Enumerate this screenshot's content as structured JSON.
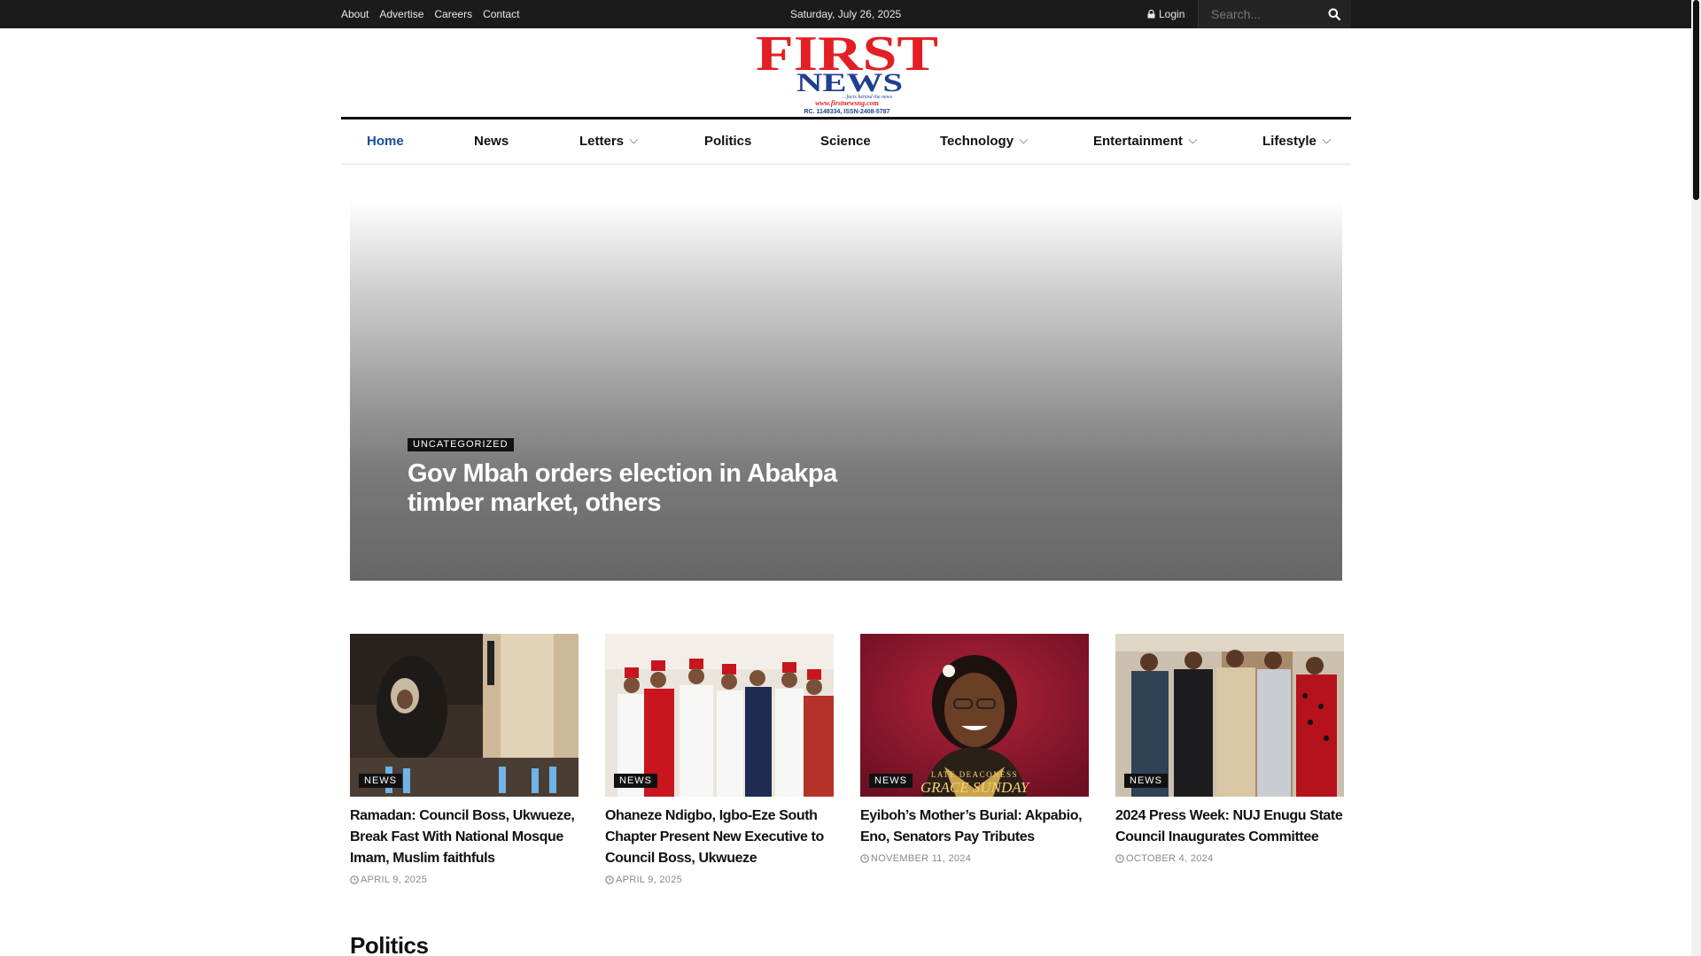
{
  "topbar": {
    "links": [
      "About",
      "Advertise",
      "Careers",
      "Contact"
    ],
    "date": "Saturday, July 26, 2025",
    "login_label": "Login",
    "search_placeholder": "Search..."
  },
  "logo": {
    "word1": "FIRST",
    "word2": "NEWS",
    "tagline": "...facts behind the news",
    "url": "www.firstnewsng.com",
    "reg": "RC. 1148334, ISSN-2408-5787"
  },
  "nav": {
    "items": [
      {
        "label": "Home",
        "active": true,
        "dropdown": false
      },
      {
        "label": "News",
        "active": false,
        "dropdown": false
      },
      {
        "label": "Letters",
        "active": false,
        "dropdown": true
      },
      {
        "label": "Politics",
        "active": false,
        "dropdown": false
      },
      {
        "label": "Science",
        "active": false,
        "dropdown": false
      },
      {
        "label": "Technology",
        "active": false,
        "dropdown": true
      },
      {
        "label": "Entertainment",
        "active": false,
        "dropdown": true
      },
      {
        "label": "Lifestyle",
        "active": false,
        "dropdown": true
      }
    ]
  },
  "hero": {
    "category": "UNCATEGORIZED",
    "headline": "Gov Mbah orders election in Abakpa timber market, others"
  },
  "cards": [
    {
      "category": "NEWS",
      "title": "Ramadan: Council Boss, Ukwueze, Break Fast With National Mosque Imam, Muslim faithfuls",
      "date": "APRIL 9, 2025"
    },
    {
      "category": "NEWS",
      "title": "Ohaneze Ndigbo, Igbo-Eze South Chapter Present New Executive to Council Boss, Ukwueze",
      "date": "APRIL 9, 2025"
    },
    {
      "category": "NEWS",
      "title": "Eyiboh’s Mother’s Burial: Akpabio, Eno, Senators Pay Tributes",
      "date": "NOVEMBER 11, 2024",
      "image_caption_1": "LATE DEACONESS",
      "image_caption_2": "GRACE SUNDAY"
    },
    {
      "category": "NEWS",
      "title": "2024 Press Week: NUJ Enugu State Council Inaugurates Committee",
      "date": "OCTOBER 4, 2024"
    }
  ],
  "section": {
    "title": "Politics"
  },
  "colors": {
    "topbar": "#1b1b1b",
    "accent": "#174e96",
    "logo_red": "#e31e24",
    "logo_blue": "#1f3f8f"
  },
  "icons": [
    "lock-icon",
    "search-icon",
    "clock-icon",
    "chevron-down-icon"
  ]
}
